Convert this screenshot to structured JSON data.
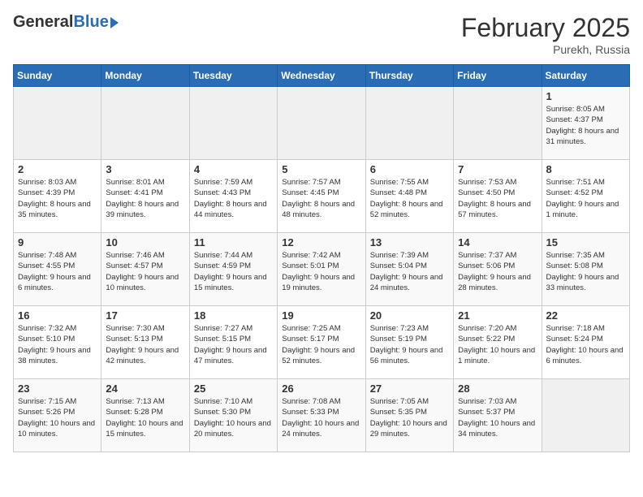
{
  "header": {
    "logo_general": "General",
    "logo_blue": "Blue",
    "month_title": "February 2025",
    "location": "Purekh, Russia"
  },
  "calendar": {
    "days_of_week": [
      "Sunday",
      "Monday",
      "Tuesday",
      "Wednesday",
      "Thursday",
      "Friday",
      "Saturday"
    ],
    "weeks": [
      [
        {
          "day": "",
          "info": ""
        },
        {
          "day": "",
          "info": ""
        },
        {
          "day": "",
          "info": ""
        },
        {
          "day": "",
          "info": ""
        },
        {
          "day": "",
          "info": ""
        },
        {
          "day": "",
          "info": ""
        },
        {
          "day": "1",
          "info": "Sunrise: 8:05 AM\nSunset: 4:37 PM\nDaylight: 8 hours and 31 minutes."
        }
      ],
      [
        {
          "day": "2",
          "info": "Sunrise: 8:03 AM\nSunset: 4:39 PM\nDaylight: 8 hours and 35 minutes."
        },
        {
          "day": "3",
          "info": "Sunrise: 8:01 AM\nSunset: 4:41 PM\nDaylight: 8 hours and 39 minutes."
        },
        {
          "day": "4",
          "info": "Sunrise: 7:59 AM\nSunset: 4:43 PM\nDaylight: 8 hours and 44 minutes."
        },
        {
          "day": "5",
          "info": "Sunrise: 7:57 AM\nSunset: 4:45 PM\nDaylight: 8 hours and 48 minutes."
        },
        {
          "day": "6",
          "info": "Sunrise: 7:55 AM\nSunset: 4:48 PM\nDaylight: 8 hours and 52 minutes."
        },
        {
          "day": "7",
          "info": "Sunrise: 7:53 AM\nSunset: 4:50 PM\nDaylight: 8 hours and 57 minutes."
        },
        {
          "day": "8",
          "info": "Sunrise: 7:51 AM\nSunset: 4:52 PM\nDaylight: 9 hours and 1 minute."
        }
      ],
      [
        {
          "day": "9",
          "info": "Sunrise: 7:48 AM\nSunset: 4:55 PM\nDaylight: 9 hours and 6 minutes."
        },
        {
          "day": "10",
          "info": "Sunrise: 7:46 AM\nSunset: 4:57 PM\nDaylight: 9 hours and 10 minutes."
        },
        {
          "day": "11",
          "info": "Sunrise: 7:44 AM\nSunset: 4:59 PM\nDaylight: 9 hours and 15 minutes."
        },
        {
          "day": "12",
          "info": "Sunrise: 7:42 AM\nSunset: 5:01 PM\nDaylight: 9 hours and 19 minutes."
        },
        {
          "day": "13",
          "info": "Sunrise: 7:39 AM\nSunset: 5:04 PM\nDaylight: 9 hours and 24 minutes."
        },
        {
          "day": "14",
          "info": "Sunrise: 7:37 AM\nSunset: 5:06 PM\nDaylight: 9 hours and 28 minutes."
        },
        {
          "day": "15",
          "info": "Sunrise: 7:35 AM\nSunset: 5:08 PM\nDaylight: 9 hours and 33 minutes."
        }
      ],
      [
        {
          "day": "16",
          "info": "Sunrise: 7:32 AM\nSunset: 5:10 PM\nDaylight: 9 hours and 38 minutes."
        },
        {
          "day": "17",
          "info": "Sunrise: 7:30 AM\nSunset: 5:13 PM\nDaylight: 9 hours and 42 minutes."
        },
        {
          "day": "18",
          "info": "Sunrise: 7:27 AM\nSunset: 5:15 PM\nDaylight: 9 hours and 47 minutes."
        },
        {
          "day": "19",
          "info": "Sunrise: 7:25 AM\nSunset: 5:17 PM\nDaylight: 9 hours and 52 minutes."
        },
        {
          "day": "20",
          "info": "Sunrise: 7:23 AM\nSunset: 5:19 PM\nDaylight: 9 hours and 56 minutes."
        },
        {
          "day": "21",
          "info": "Sunrise: 7:20 AM\nSunset: 5:22 PM\nDaylight: 10 hours and 1 minute."
        },
        {
          "day": "22",
          "info": "Sunrise: 7:18 AM\nSunset: 5:24 PM\nDaylight: 10 hours and 6 minutes."
        }
      ],
      [
        {
          "day": "23",
          "info": "Sunrise: 7:15 AM\nSunset: 5:26 PM\nDaylight: 10 hours and 10 minutes."
        },
        {
          "day": "24",
          "info": "Sunrise: 7:13 AM\nSunset: 5:28 PM\nDaylight: 10 hours and 15 minutes."
        },
        {
          "day": "25",
          "info": "Sunrise: 7:10 AM\nSunset: 5:30 PM\nDaylight: 10 hours and 20 minutes."
        },
        {
          "day": "26",
          "info": "Sunrise: 7:08 AM\nSunset: 5:33 PM\nDaylight: 10 hours and 24 minutes."
        },
        {
          "day": "27",
          "info": "Sunrise: 7:05 AM\nSunset: 5:35 PM\nDaylight: 10 hours and 29 minutes."
        },
        {
          "day": "28",
          "info": "Sunrise: 7:03 AM\nSunset: 5:37 PM\nDaylight: 10 hours and 34 minutes."
        },
        {
          "day": "",
          "info": ""
        }
      ]
    ]
  }
}
